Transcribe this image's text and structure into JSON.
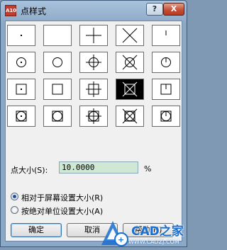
{
  "window": {
    "title": "点样式",
    "app_icon_text": "A10",
    "help_label": "?",
    "close_label": "X"
  },
  "point_styles": {
    "selected_index": 13,
    "grid_rows": 4,
    "grid_cols": 5,
    "styles": [
      {
        "id": 0,
        "base": "dot",
        "enclosure": "none"
      },
      {
        "id": 1,
        "base": "blank",
        "enclosure": "none"
      },
      {
        "id": 2,
        "base": "plus",
        "enclosure": "none"
      },
      {
        "id": 3,
        "base": "x",
        "enclosure": "none"
      },
      {
        "id": 4,
        "base": "tick",
        "enclosure": "none"
      },
      {
        "id": 5,
        "base": "dot",
        "enclosure": "circle"
      },
      {
        "id": 6,
        "base": "blank",
        "enclosure": "circle"
      },
      {
        "id": 7,
        "base": "plus",
        "enclosure": "circle"
      },
      {
        "id": 8,
        "base": "x",
        "enclosure": "circle"
      },
      {
        "id": 9,
        "base": "tick",
        "enclosure": "circle"
      },
      {
        "id": 10,
        "base": "dot",
        "enclosure": "square"
      },
      {
        "id": 11,
        "base": "blank",
        "enclosure": "square"
      },
      {
        "id": 12,
        "base": "plus",
        "enclosure": "square"
      },
      {
        "id": 13,
        "base": "x",
        "enclosure": "square"
      },
      {
        "id": 14,
        "base": "tick",
        "enclosure": "square"
      },
      {
        "id": 15,
        "base": "dot",
        "enclosure": "circle-square"
      },
      {
        "id": 16,
        "base": "blank",
        "enclosure": "circle-square"
      },
      {
        "id": 17,
        "base": "plus",
        "enclosure": "circle-square"
      },
      {
        "id": 18,
        "base": "x",
        "enclosure": "circle-square"
      },
      {
        "id": 19,
        "base": "tick",
        "enclosure": "circle-square"
      }
    ]
  },
  "point_size": {
    "label": "点大小(S):",
    "value": "10.0000",
    "unit": "%"
  },
  "size_mode": {
    "options": [
      {
        "label": "相对于屏幕设置大小(R)",
        "selected": true
      },
      {
        "label": "按绝对单位设置大小(A)",
        "selected": false
      }
    ]
  },
  "buttons": {
    "ok": "确定",
    "cancel": "取消",
    "help": "帮助(H)"
  },
  "watermark": {
    "text": "CAD之家",
    "url": "WWW.CADZJ.COM",
    "accent": "#1a6fd1"
  },
  "colors": {
    "titlebar": "#a9c2dc",
    "client_bg": "#f0f0f0",
    "input_bg": "#cfe8d4",
    "close_red": "#c24b33"
  }
}
